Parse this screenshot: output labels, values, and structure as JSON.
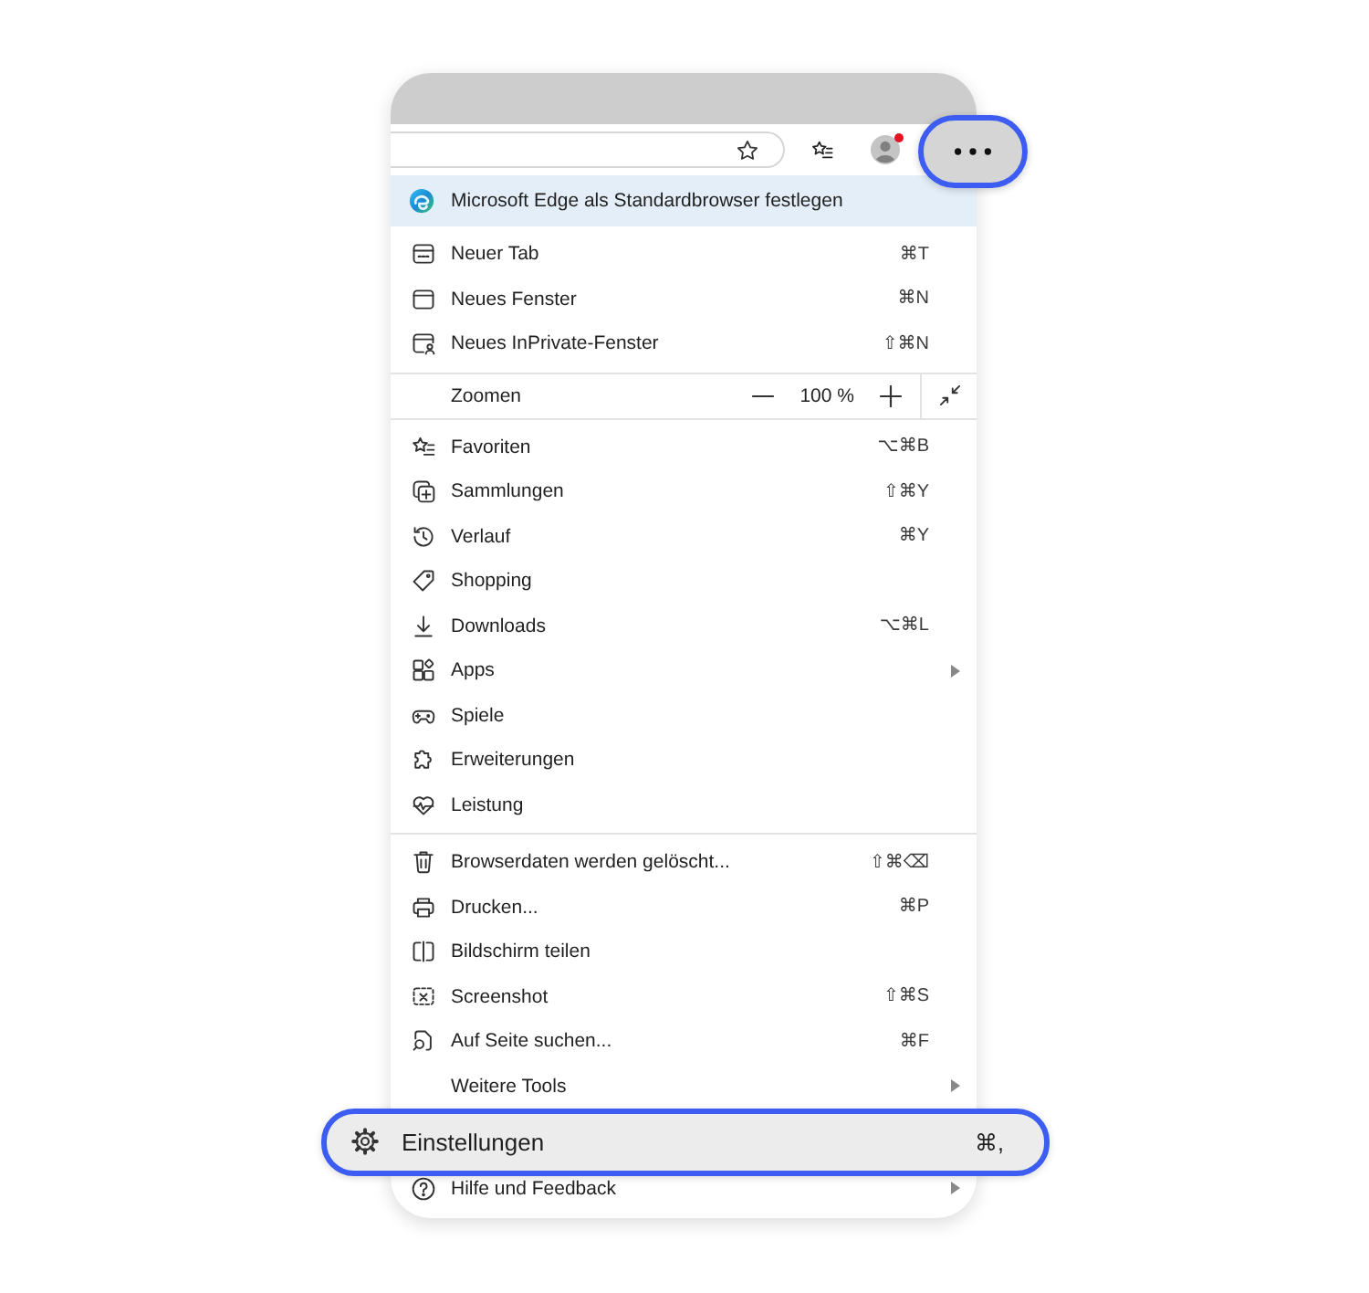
{
  "toolbar": {
    "profile": {
      "notification": true
    },
    "more_button": {
      "highlighted": true
    }
  },
  "banner": {
    "text": "Microsoft Edge als Standardbrowser festlegen"
  },
  "menu": {
    "sections": [
      {
        "items": [
          {
            "kind": "item",
            "label": "Neuer Tab",
            "shortcut": "⌘T",
            "submenu": false,
            "highlighted": false
          },
          {
            "kind": "item",
            "label": "Neues Fenster",
            "shortcut": "⌘N",
            "submenu": false,
            "highlighted": false
          },
          {
            "kind": "item",
            "label": "Neues InPrivate-Fenster",
            "shortcut": "⇧⌘N",
            "submenu": false,
            "highlighted": false
          }
        ]
      },
      {
        "items": [
          {
            "kind": "zoom",
            "label": "Zoomen",
            "value": "100 %"
          }
        ]
      },
      {
        "items": [
          {
            "kind": "item",
            "label": "Favoriten",
            "shortcut": "⌥⌘B",
            "submenu": false,
            "highlighted": false
          },
          {
            "kind": "item",
            "label": "Sammlungen",
            "shortcut": "⇧⌘Y",
            "submenu": false,
            "highlighted": false
          },
          {
            "kind": "item",
            "label": "Verlauf",
            "shortcut": "⌘Y",
            "submenu": false,
            "highlighted": false
          },
          {
            "kind": "item",
            "label": "Shopping",
            "submenu": false,
            "highlighted": false
          },
          {
            "kind": "item",
            "label": "Downloads",
            "shortcut": "⌥⌘L",
            "submenu": false,
            "highlighted": false
          },
          {
            "kind": "item",
            "label": "Apps",
            "submenu": true,
            "highlighted": false
          },
          {
            "kind": "item",
            "label": "Spiele",
            "submenu": false,
            "highlighted": false
          },
          {
            "kind": "item",
            "label": "Erweiterungen",
            "submenu": false,
            "highlighted": false
          },
          {
            "kind": "item",
            "label": "Leistung",
            "submenu": false,
            "highlighted": false
          }
        ]
      },
      {
        "items": [
          {
            "kind": "item",
            "label": "Browserdaten werden gelöscht...",
            "shortcut": "⇧⌘⌫",
            "submenu": false,
            "highlighted": false
          },
          {
            "kind": "item",
            "label": "Drucken...",
            "shortcut": "⌘P",
            "submenu": false,
            "highlighted": false
          },
          {
            "kind": "item",
            "label": "Bildschirm teilen",
            "submenu": false,
            "highlighted": false
          },
          {
            "kind": "item",
            "label": "Screenshot",
            "shortcut": "⇧⌘S",
            "submenu": false,
            "highlighted": false
          },
          {
            "kind": "item",
            "label": "Auf Seite suchen...",
            "shortcut": "⌘F",
            "submenu": false,
            "highlighted": false
          },
          {
            "kind": "item",
            "label": "Weitere Tools",
            "submenu": true,
            "highlighted": false
          }
        ]
      },
      {
        "items": [
          {
            "kind": "item",
            "label": "Einstellungen",
            "shortcut": "⌘,",
            "submenu": false,
            "highlighted": true
          },
          {
            "kind": "item",
            "label": "Hilfe und Feedback",
            "submenu": true,
            "highlighted": false
          }
        ]
      }
    ]
  }
}
